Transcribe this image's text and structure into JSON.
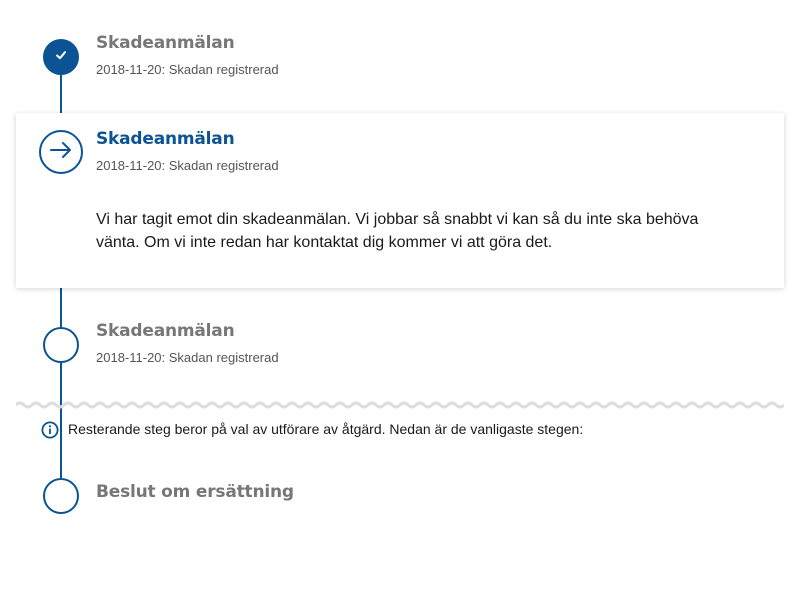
{
  "steps": [
    {
      "title": "Skadeanmälan",
      "subtitle": "2018-11-20: Skadan registrerad",
      "state": "done",
      "icon": "check-icon"
    },
    {
      "title": "Skadeanmälan",
      "subtitle": "2018-11-20: Skadan registrerad",
      "state": "current",
      "icon": "arrow-right-icon",
      "body": "Vi har tagit emot din skadeanmälan. Vi jobbar så snabbt vi kan så du inte ska behöva vänta. Om vi inte redan har kontaktat dig kommer vi att göra det."
    },
    {
      "title": "Skadeanmälan",
      "subtitle": "2018-11-20: Skadan registrerad",
      "state": "pending"
    }
  ],
  "info": {
    "icon": "info-icon",
    "text": "Resterande steg beror på val av utförare av åtgärd. Nedan är de vanligaste stegen:"
  },
  "future_steps": [
    {
      "title": "Beslut om ersättning",
      "state": "pending"
    }
  ],
  "colors": {
    "accent": "#0b5394",
    "muted_title": "#777777",
    "wave": "#dddddd"
  }
}
